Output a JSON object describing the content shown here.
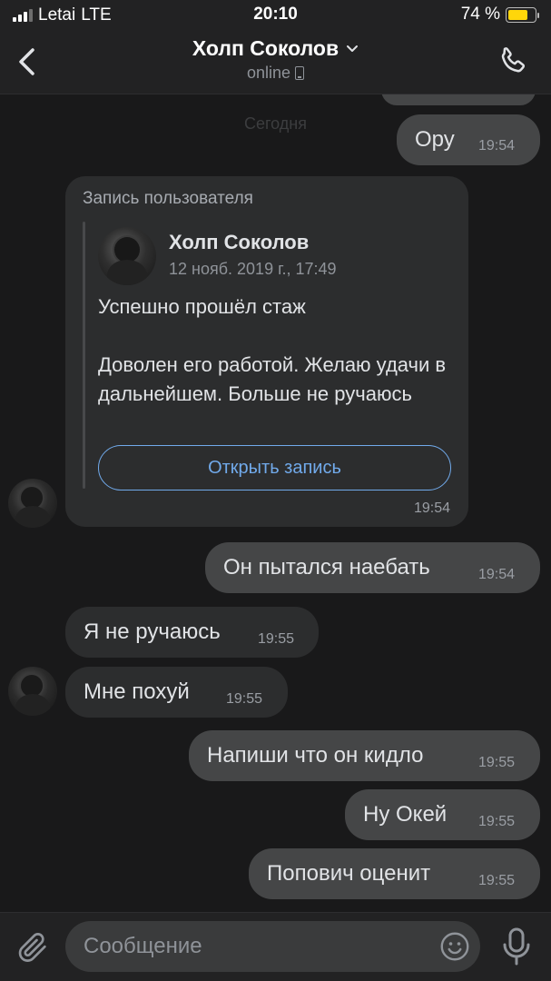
{
  "status_bar": {
    "carrier": "Letai",
    "network": "LTE",
    "time": "20:10",
    "battery": "74 %",
    "battery_level": 0.74
  },
  "header": {
    "title": "Холп Соколов",
    "subtitle": "online",
    "back_icon": "chevron-left-icon",
    "call_icon": "phone-icon"
  },
  "date_separator": "Сегодня",
  "messages": [
    {
      "direction": "out",
      "text": "Ору",
      "time": "19:54"
    },
    {
      "direction": "out",
      "text": "Он пытался наебать",
      "time": "19:54"
    },
    {
      "direction": "in",
      "text": "Я не ручаюсь",
      "time": "19:55"
    },
    {
      "direction": "in",
      "text": "Мне похуй",
      "time": "19:55"
    },
    {
      "direction": "out",
      "text": "Напиши что он кидло",
      "time": "19:55"
    },
    {
      "direction": "out",
      "text": "Ну Окей",
      "time": "19:55"
    },
    {
      "direction": "out",
      "text": "Попович оценит",
      "time": "19:55"
    }
  ],
  "post": {
    "caption": "Запись пользователя",
    "author": "Холп Соколов",
    "date": "12 нояб. 2019 г., 17:49",
    "text": "Успешно прошёл стаж\n\nДоволен его работой. Желаю удачи в дальнейшем. Больше не ручаюсь",
    "button": "Открыть запись",
    "time": "19:54"
  },
  "composer": {
    "placeholder": "Сообщение",
    "attach_icon": "paperclip-icon",
    "emoji_icon": "emoji-icon",
    "mic_icon": "microphone-icon"
  },
  "colors": {
    "background": "#19191a",
    "bar": "#222223",
    "bubble_out": "#454647",
    "bubble_in": "#2c2d2e",
    "accent": "#71aaeb",
    "battery": "#ffd60a"
  }
}
